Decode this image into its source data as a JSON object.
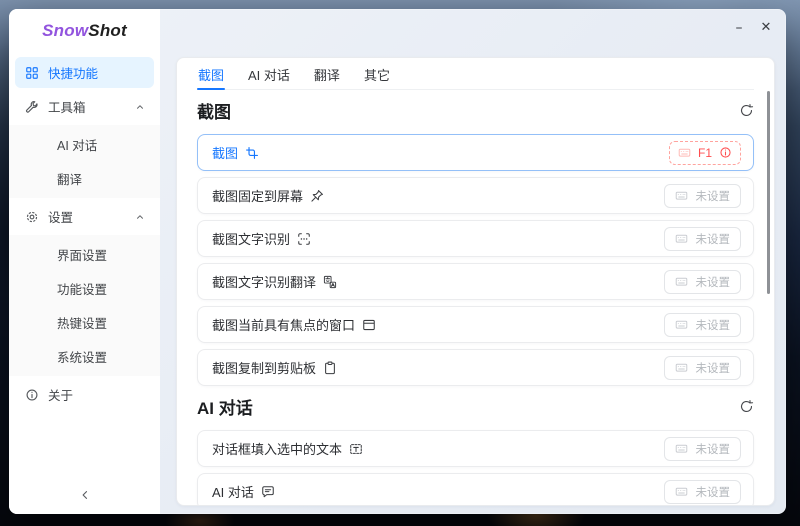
{
  "colors": {
    "accent": "#1677ff",
    "danger": "#ff4d4f",
    "brand_purple": "#9254de",
    "selected_bg": "#e6f4ff"
  },
  "brand": {
    "first": "Snow",
    "second": "Shot"
  },
  "window_controls": {
    "minimize": "–",
    "close": "✕"
  },
  "sidebar": {
    "items": [
      {
        "label": "快捷功能",
        "icon": "grid-icon",
        "selected": true
      },
      {
        "label": "工具箱",
        "icon": "tool-icon",
        "expanded": true
      },
      {
        "label": "AI 对话",
        "sub": true
      },
      {
        "label": "翻译",
        "sub": true
      },
      {
        "label": "设置",
        "icon": "gear-icon",
        "expanded": true
      },
      {
        "label": "界面设置",
        "sub": true
      },
      {
        "label": "功能设置",
        "sub": true
      },
      {
        "label": "热键设置",
        "sub": true
      },
      {
        "label": "系统设置",
        "sub": true
      },
      {
        "label": "关于",
        "icon": "info-icon"
      }
    ],
    "collapse_icon": "chevron-left-icon"
  },
  "tabs": [
    {
      "label": "截图",
      "active": true
    },
    {
      "label": "AI 对话"
    },
    {
      "label": "翻译"
    },
    {
      "label": "其它"
    }
  ],
  "sections": [
    {
      "title": "截图",
      "refresh_icon": "refresh-icon",
      "rows": [
        {
          "label": "截图",
          "icon": "screenshot-icon",
          "hotkey": "F1",
          "status": "assigned",
          "warning_icon": "info-circle-icon"
        },
        {
          "label": "截图固定到屏幕",
          "icon": "pin-icon",
          "hotkey": "未设置",
          "status": "unset"
        },
        {
          "label": "截图文字识别",
          "icon": "ocr-icon",
          "hotkey": "未设置",
          "status": "unset"
        },
        {
          "label": "截图文字识别翻译",
          "icon": "ocr-translate-icon",
          "hotkey": "未设置",
          "status": "unset"
        },
        {
          "label": "截图当前具有焦点的窗口",
          "icon": "window-icon",
          "hotkey": "未设置",
          "status": "unset"
        },
        {
          "label": "截图复制到剪贴板",
          "icon": "clipboard-icon",
          "hotkey": "未设置",
          "status": "unset"
        }
      ]
    },
    {
      "title": "AI 对话",
      "refresh_icon": "refresh-icon",
      "rows": [
        {
          "label": "对话框填入选中的文本",
          "icon": "text-select-icon",
          "hotkey": "未设置",
          "status": "unset"
        },
        {
          "label": "AI 对话",
          "icon": "chat-bubble-icon",
          "hotkey": "未设置",
          "status": "unset"
        }
      ]
    }
  ]
}
